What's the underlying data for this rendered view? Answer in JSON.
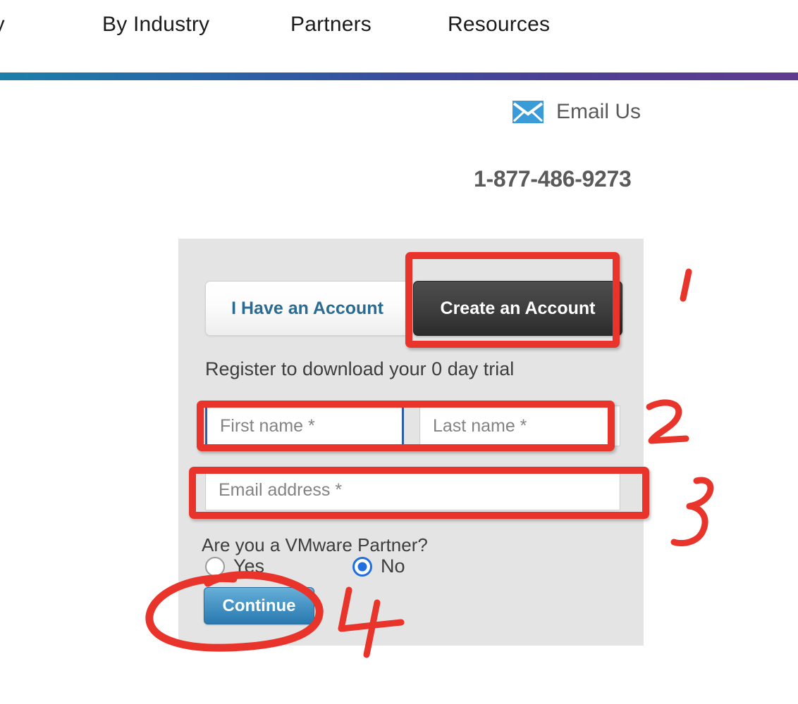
{
  "nav": {
    "items": [
      {
        "label": "rity"
      },
      {
        "label": "By Industry"
      },
      {
        "label": "Partners"
      },
      {
        "label": "Resources"
      }
    ]
  },
  "contact": {
    "email_icon": "envelope-icon",
    "email_label": "Email Us",
    "phone": "1-877-486-9273"
  },
  "panel": {
    "tabs": [
      {
        "label": "I Have an Account",
        "selected": false
      },
      {
        "label": "Create an Account",
        "selected": true
      }
    ],
    "subtitle": "Register to download your 0 day trial",
    "fields": {
      "first_name": {
        "placeholder": "First name *",
        "value": "",
        "focused": true
      },
      "last_name": {
        "placeholder": "Last name *",
        "value": "",
        "focused": false
      },
      "email": {
        "placeholder": "Email address *",
        "value": "",
        "focused": false
      }
    },
    "partner_question": "Are you a VMware Partner?",
    "radios": [
      {
        "label": "Yes",
        "checked": false
      },
      {
        "label": "No",
        "checked": true
      }
    ],
    "submit_label": "Continue"
  },
  "annotations": {
    "marks": [
      {
        "name": "step-1",
        "text": "1"
      },
      {
        "name": "step-2",
        "text": "2"
      },
      {
        "name": "step-3",
        "text": "3"
      },
      {
        "name": "step-4",
        "text": "4"
      }
    ],
    "color": "#e8342a"
  },
  "colors": {
    "accent_blue": "#2a7ab0",
    "tab_active_bg": "#3d3d3d",
    "tab_link": "#2a6b91",
    "panel_bg": "#e4e4e4",
    "annotation_red": "#e8342a",
    "focus_blue": "#2c5fa8",
    "radio_blue": "#1f6fe0",
    "gradient_start": "#1b7fa8",
    "gradient_end": "#5f3b8f"
  }
}
